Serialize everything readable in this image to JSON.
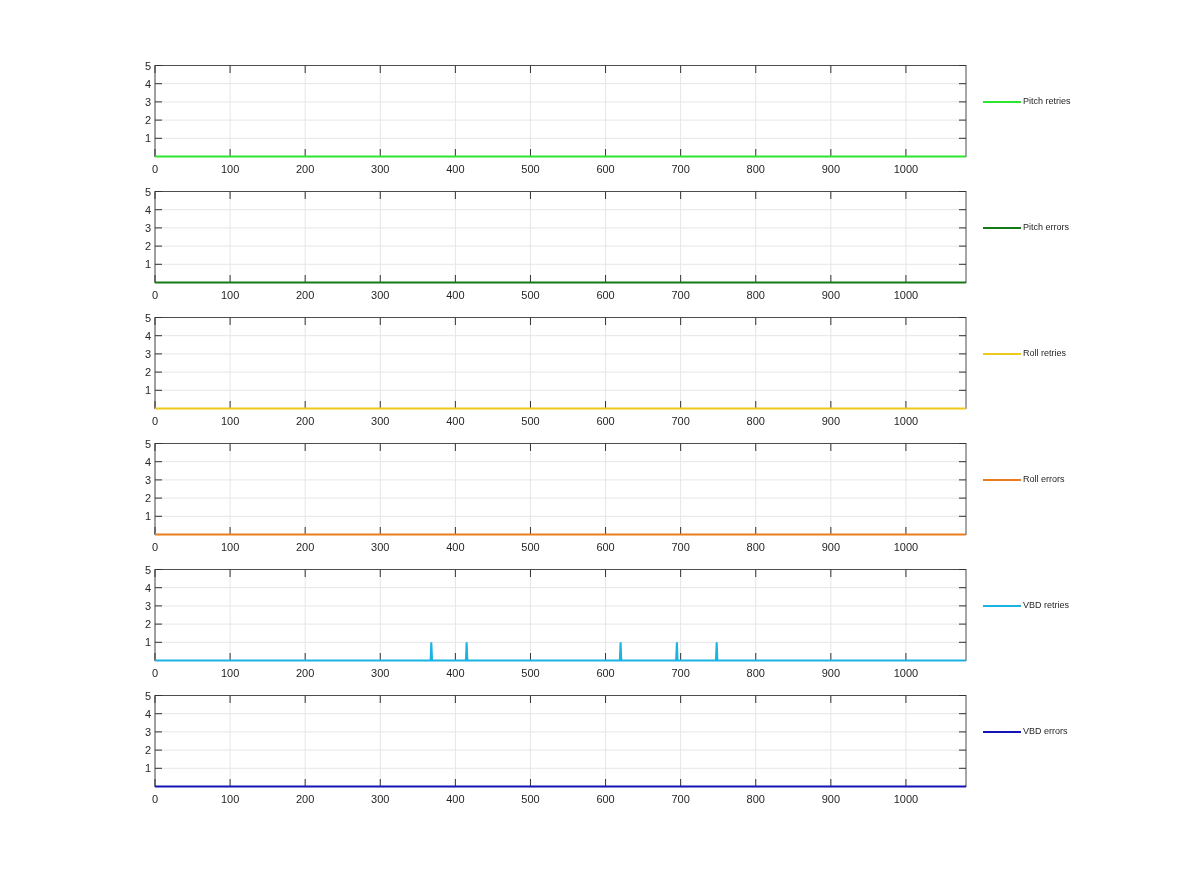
{
  "charts": [
    {
      "chart_data": {
        "type": "line",
        "grid": true,
        "xlim": [
          0,
          1080
        ],
        "ylim": [
          0,
          5
        ],
        "xticks": [
          0,
          100,
          200,
          300,
          400,
          500,
          600,
          700,
          800,
          900,
          1000
        ],
        "yticks": [
          1,
          2,
          3,
          4,
          5
        ],
        "x": [
          0,
          1080
        ],
        "series": [
          {
            "name": "Pitch retries",
            "color": "#2ee52e",
            "values": [
              0,
              0
            ]
          }
        ]
      }
    },
    {
      "chart_data": {
        "type": "line",
        "grid": true,
        "xlim": [
          0,
          1080
        ],
        "ylim": [
          0,
          5
        ],
        "xticks": [
          0,
          100,
          200,
          300,
          400,
          500,
          600,
          700,
          800,
          900,
          1000
        ],
        "yticks": [
          1,
          2,
          3,
          4,
          5
        ],
        "x": [
          0,
          1080
        ],
        "series": [
          {
            "name": "Pitch errors",
            "color": "#157a15",
            "values": [
              0,
              0
            ]
          }
        ]
      }
    },
    {
      "chart_data": {
        "type": "line",
        "grid": true,
        "xlim": [
          0,
          1080
        ],
        "ylim": [
          0,
          5
        ],
        "xticks": [
          0,
          100,
          200,
          300,
          400,
          500,
          600,
          700,
          800,
          900,
          1000
        ],
        "yticks": [
          1,
          2,
          3,
          4,
          5
        ],
        "x": [
          0,
          1080
        ],
        "series": [
          {
            "name": "Roll retries",
            "color": "#edc91c",
            "values": [
              0,
              0
            ]
          }
        ]
      }
    },
    {
      "chart_data": {
        "type": "line",
        "grid": true,
        "xlim": [
          0,
          1080
        ],
        "ylim": [
          0,
          5
        ],
        "xticks": [
          0,
          100,
          200,
          300,
          400,
          500,
          600,
          700,
          800,
          900,
          1000
        ],
        "yticks": [
          1,
          2,
          3,
          4,
          5
        ],
        "x": [
          0,
          1080
        ],
        "series": [
          {
            "name": "Roll errors",
            "color": "#ec7d1e",
            "values": [
              0,
              0
            ]
          }
        ]
      }
    },
    {
      "chart_data": {
        "type": "line",
        "grid": true,
        "xlim": [
          0,
          1080
        ],
        "ylim": [
          0,
          5
        ],
        "xticks": [
          0,
          100,
          200,
          300,
          400,
          500,
          600,
          700,
          800,
          900,
          1000
        ],
        "yticks": [
          1,
          2,
          3,
          4,
          5
        ],
        "x": [
          0,
          367,
          368,
          369,
          414,
          415,
          416,
          619,
          620,
          621,
          694,
          695,
          696,
          747,
          748,
          749,
          1080
        ],
        "series": [
          {
            "name": "VBD retries",
            "color": "#1ab4e4",
            "values": [
              0,
              0,
              1,
              0,
              0,
              1,
              0,
              0,
              1,
              0,
              0,
              1,
              0,
              0,
              1,
              0,
              0
            ]
          }
        ]
      }
    },
    {
      "chart_data": {
        "type": "line",
        "grid": true,
        "xlim": [
          0,
          1080
        ],
        "ylim": [
          0,
          5
        ],
        "xticks": [
          0,
          100,
          200,
          300,
          400,
          500,
          600,
          700,
          800,
          900,
          1000
        ],
        "yticks": [
          1,
          2,
          3,
          4,
          5
        ],
        "x": [
          0,
          1080
        ],
        "series": [
          {
            "name": "VBD errors",
            "color": "#1414b4",
            "values": [
              0,
              0
            ]
          }
        ]
      }
    }
  ]
}
